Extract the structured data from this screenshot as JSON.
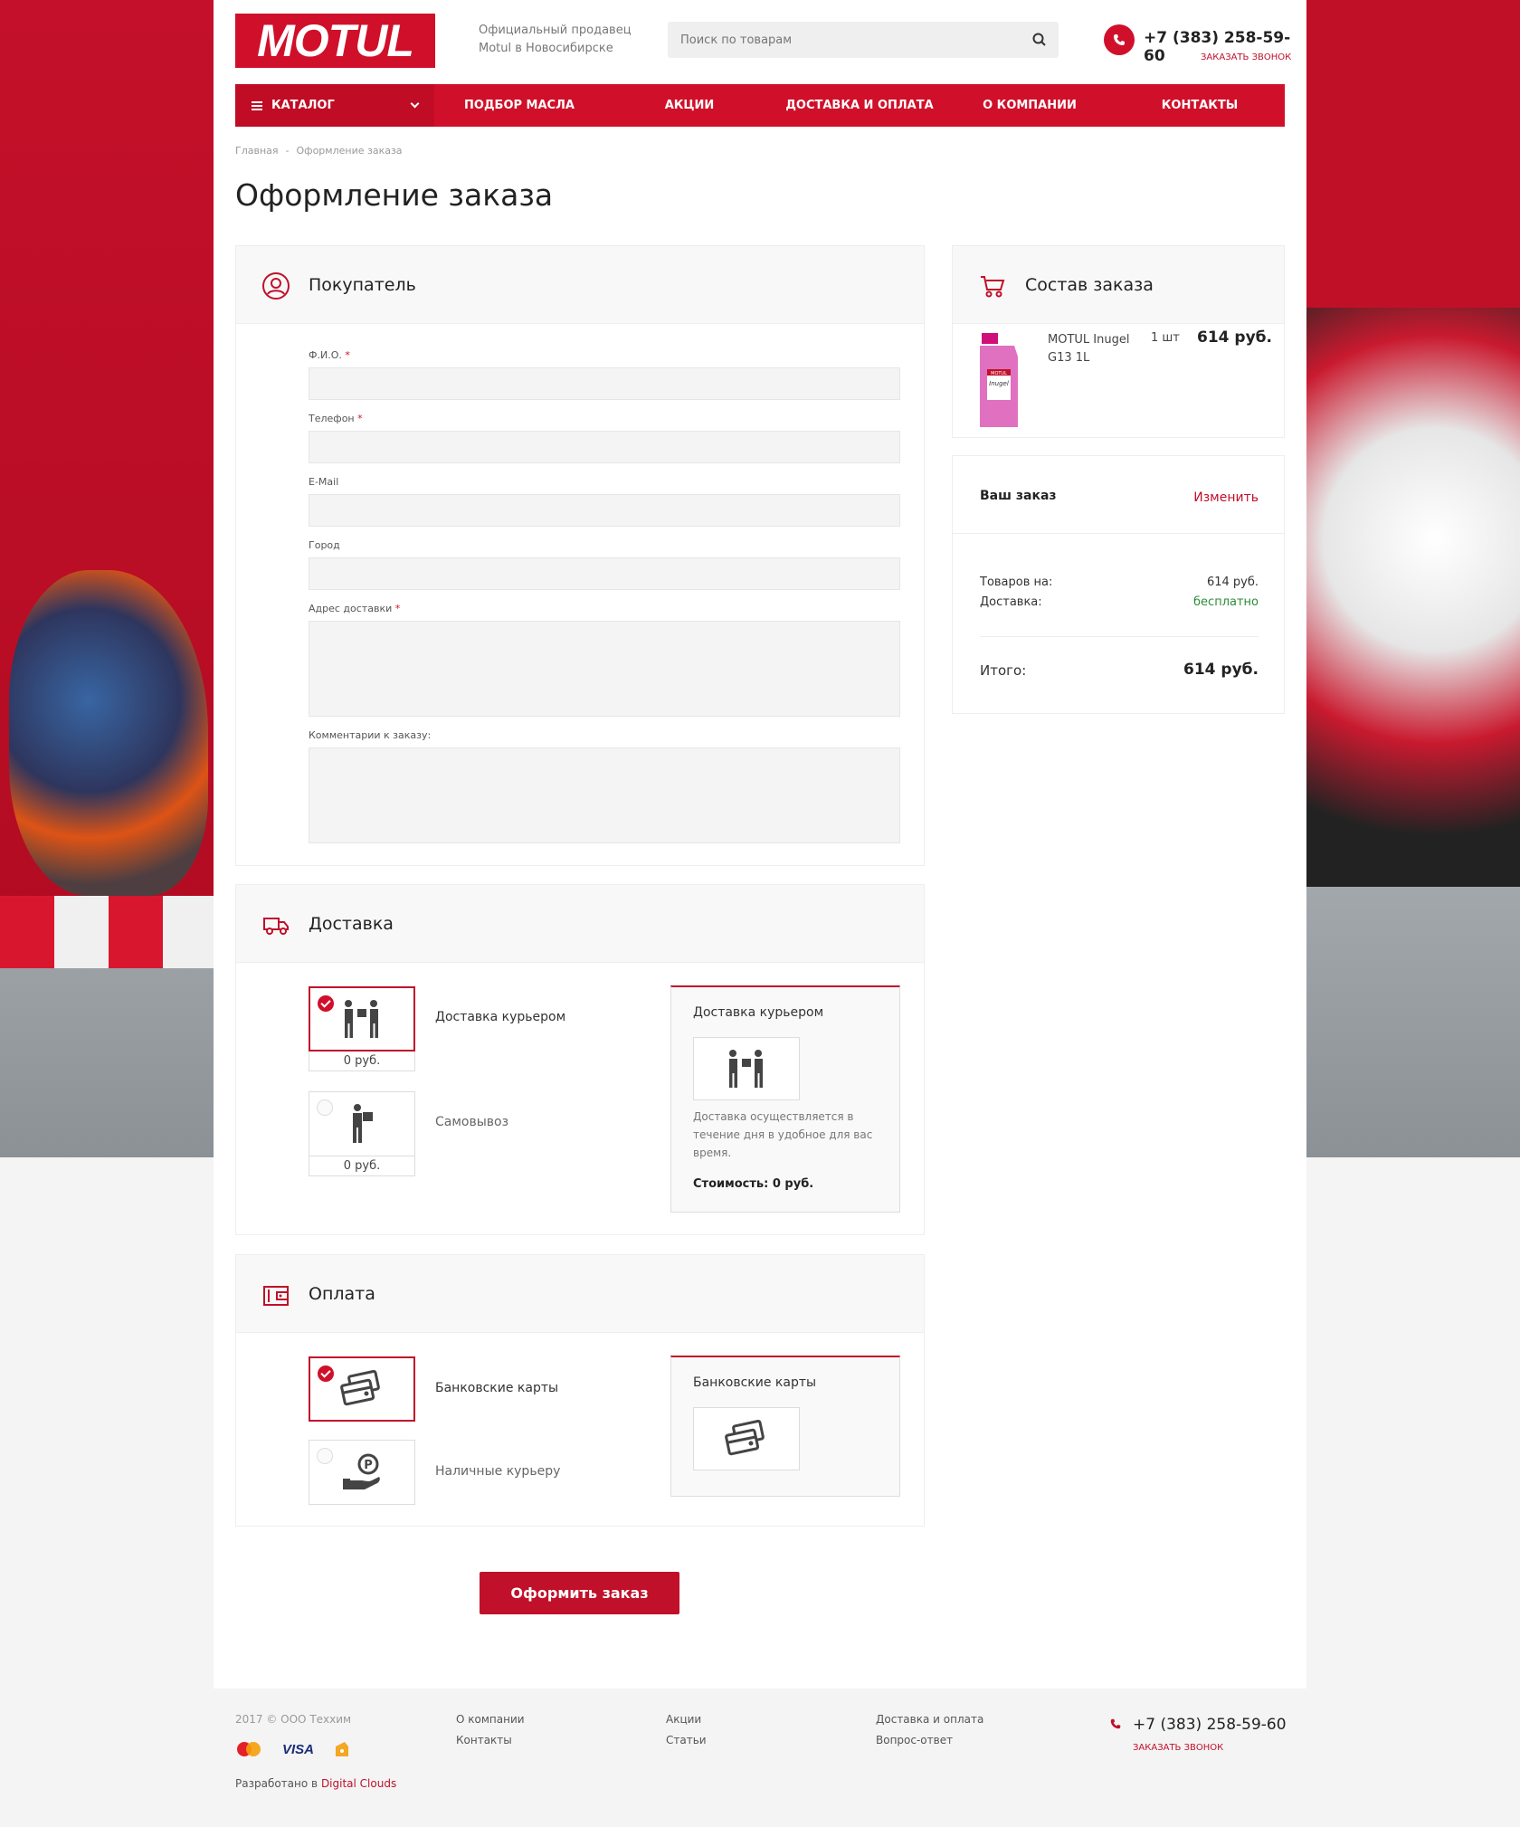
{
  "header": {
    "logo_text": "MOTUL",
    "seller_line1": "Официальный продавец",
    "seller_line2": "Motul в Новосибирске",
    "search_placeholder": "Поиск по товарам",
    "phone": "+7 (383) 258-59-60",
    "callback": "ЗАКАЗАТЬ ЗВОНОК"
  },
  "nav": {
    "catalog": "КАТАЛОГ",
    "items": [
      "ПОДБОР МАСЛА",
      "АКЦИИ",
      "ДОСТАВКА И ОПЛАТА",
      "О КОМПАНИИ",
      "КОНТАКТЫ"
    ]
  },
  "breadcrumb": {
    "home": "Главная",
    "current": "Оформление заказа"
  },
  "page_title": "Оформление заказа",
  "buyer": {
    "title": "Покупатель",
    "fields": [
      {
        "label": "Ф.И.О.",
        "required": "*"
      },
      {
        "label": "Телефон",
        "required": "*"
      },
      {
        "label": "E-Mail",
        "required": ""
      },
      {
        "label": "Город",
        "required": ""
      },
      {
        "label": "Адрес доставки",
        "required": "*"
      },
      {
        "label": "Комментарии к заказу:",
        "required": ""
      }
    ]
  },
  "delivery": {
    "title": "Доставка",
    "options": [
      {
        "label": "Доставка курьером",
        "price": "0 руб.",
        "selected": true
      },
      {
        "label": "Самовывоз",
        "price": "0 руб.",
        "selected": false
      }
    ],
    "info_title": "Доставка курьером",
    "info_desc": "Доставка осуществляется в течение дня в удобное для вас время.",
    "info_cost": "Стоимость: 0 руб."
  },
  "payment": {
    "title": "Оплата",
    "options": [
      {
        "label": "Банковские карты",
        "selected": true
      },
      {
        "label": "Наличные курьеру",
        "selected": false
      }
    ],
    "info_title": "Банковские карты"
  },
  "submit_label": "Оформить заказ",
  "order": {
    "title": "Состав заказа",
    "product_name": "MOTUL Inugel G13 1L",
    "product_qty": "1 шт",
    "product_price": "614 руб."
  },
  "summary": {
    "title": "Ваш заказ",
    "edit": "Изменить",
    "goods_label": "Товаров на:",
    "goods_value": "614 руб.",
    "delivery_label": "Доставка:",
    "delivery_value": "бесплатно",
    "total_label": "Итого:",
    "total_value": "614 руб."
  },
  "footer": {
    "copyright": "2017 © ООО Теххим",
    "dev_prefix": "Разработано в",
    "dev_link": "Digital Clouds",
    "col1": [
      "О компании",
      "Контакты"
    ],
    "col2": [
      "Акции",
      "Статьи"
    ],
    "col3": [
      "Доставка и оплата",
      "Вопрос-ответ"
    ],
    "phone": "+7 (383) 258-59-60",
    "callback": "ЗАКАЗАТЬ ЗВОНОК",
    "visa": "VISA"
  },
  "colors": {
    "brand": "#d0102a",
    "free": "#2e8b3a"
  }
}
